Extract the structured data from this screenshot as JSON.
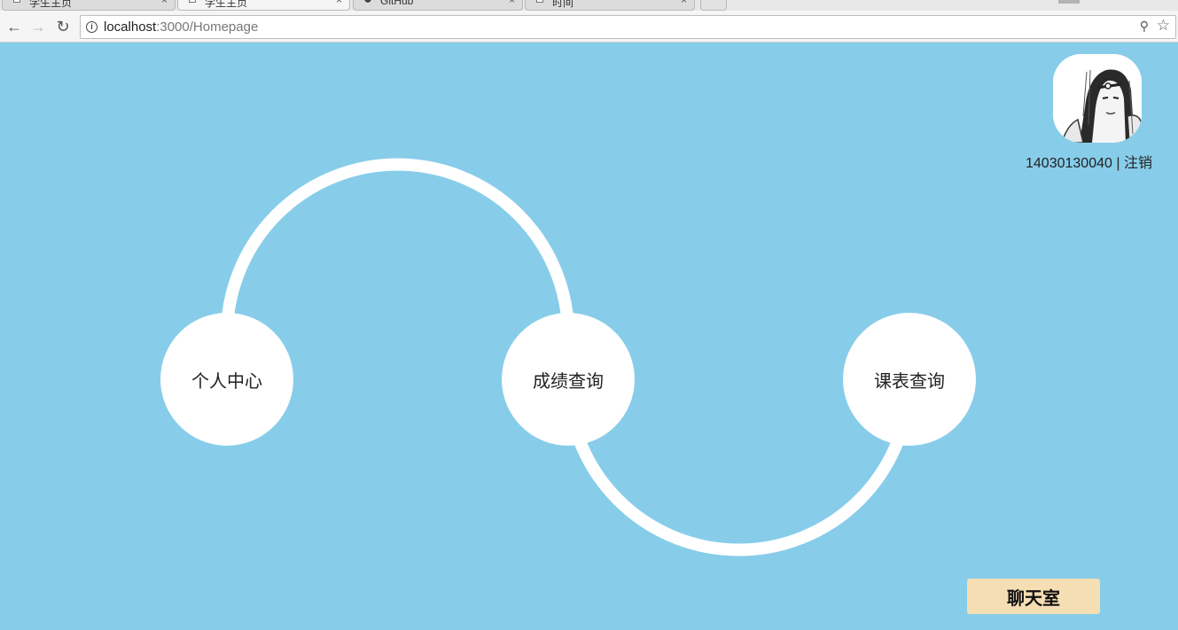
{
  "browser": {
    "tabs": [
      {
        "label": "学生主页",
        "active": false
      },
      {
        "label": "学生主页",
        "active": true
      },
      {
        "label": "GitHub",
        "active": false
      },
      {
        "label": "时间",
        "active": false
      }
    ],
    "close_glyph": "×",
    "nav": {
      "back_icon": "←",
      "forward_icon": "→",
      "reload_icon": "↻"
    },
    "url_host": "localhost",
    "url_rest": ":3000/Homepage",
    "info_glyph": "i",
    "key_glyph": "⚲",
    "star_glyph": "☆"
  },
  "user": {
    "id": "14030130040",
    "separator": " | ",
    "logout_label": "注销"
  },
  "nodes": [
    {
      "label": "个人中心"
    },
    {
      "label": "成绩查询"
    },
    {
      "label": "课表查询"
    }
  ],
  "chat_button": "聊天室",
  "colors": {
    "background": "#87cdea",
    "node_fill": "#ffffff",
    "chat_button": "#f5deb3"
  }
}
